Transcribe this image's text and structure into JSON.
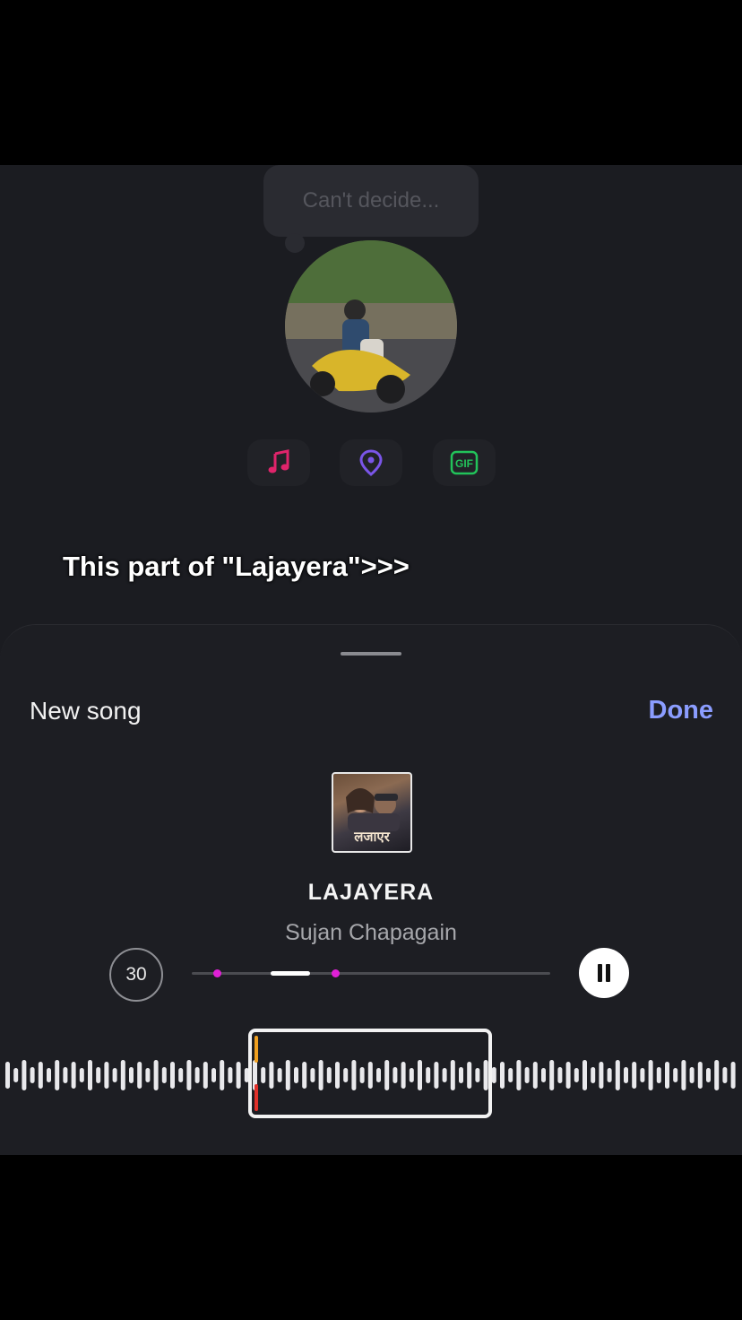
{
  "story": {
    "prompt_bubble": "Can't decide...",
    "caption": "This part of \"Lajayera\">>>",
    "quick_actions": [
      {
        "name": "music",
        "icon": "music-note-icon",
        "color": "#e0246b"
      },
      {
        "name": "location",
        "icon": "location-pin-icon",
        "color": "#7a55e8"
      },
      {
        "name": "gif",
        "icon": "gif-icon",
        "label": "GIF",
        "color": "#22c35a"
      }
    ]
  },
  "sheet": {
    "left_label": "New song",
    "done_label": "Done",
    "accent_color": "#8b9dff"
  },
  "song": {
    "title": "LAJAYERA",
    "artist": "Sujan Chapagain",
    "cover_text": "लजाएर"
  },
  "player": {
    "duration_label": "30",
    "state": "playing",
    "clip_start_fraction": 0.07,
    "clip_end_fraction": 0.4,
    "playhead_fill_fraction": [
      0.22,
      0.33
    ],
    "marker_color": "#e020d6"
  },
  "waveform": {
    "selection_start_fraction": 0.34,
    "selection_end_fraction": 0.66
  }
}
